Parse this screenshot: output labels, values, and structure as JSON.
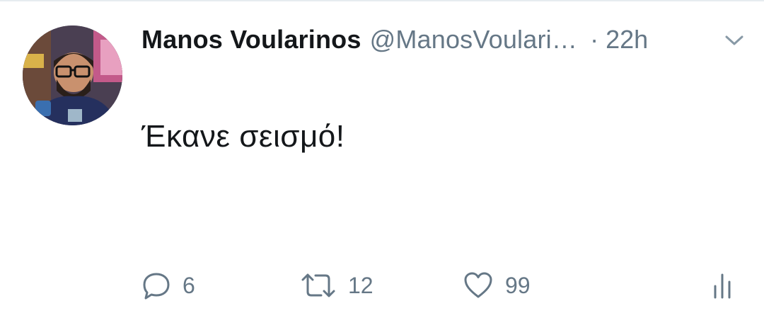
{
  "tweet": {
    "display_name": "Manos Voularinos",
    "handle": "@ManosVoulari…",
    "separator": "·",
    "time": "22h",
    "text": "Έκανε σεισμό!"
  },
  "actions": {
    "replies": "6",
    "retweets": "12",
    "likes": "99"
  },
  "icons": {
    "reply": "reply-icon",
    "retweet": "retweet-icon",
    "like": "heart-icon",
    "analytics": "analytics-icon",
    "caret": "chevron-down-icon"
  },
  "colors": {
    "text_primary": "#14171a",
    "text_secondary": "#657786",
    "divider": "#e6ecf0"
  }
}
